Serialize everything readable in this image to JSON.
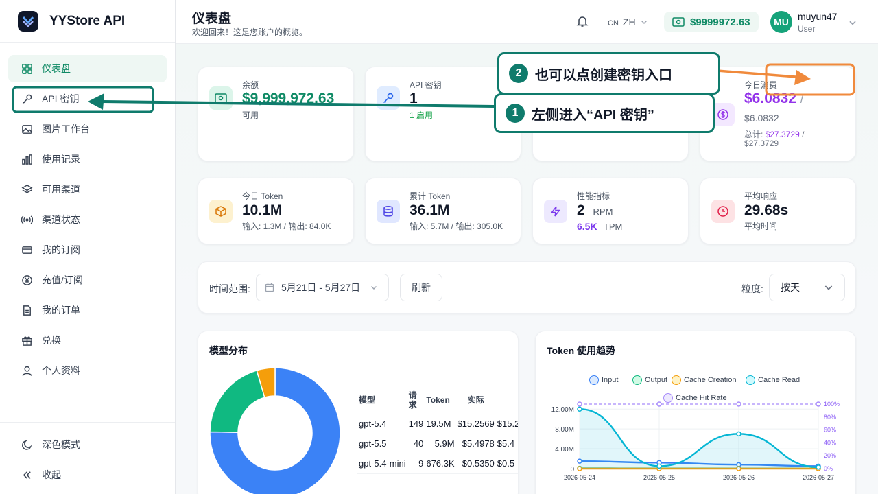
{
  "brand": {
    "name": "YYStore API"
  },
  "sidebar": {
    "items": [
      {
        "label": "仪表盘",
        "icon": "grid-icon"
      },
      {
        "label": "API 密钥",
        "icon": "key-icon"
      },
      {
        "label": "图片工作台",
        "icon": "image-icon"
      },
      {
        "label": "使用记录",
        "icon": "bar-chart-icon"
      },
      {
        "label": "可用渠道",
        "icon": "layers-icon"
      },
      {
        "label": "渠道状态",
        "icon": "signal-icon"
      },
      {
        "label": "我的订阅",
        "icon": "card-icon"
      },
      {
        "label": "充值/订阅",
        "icon": "yen-icon"
      },
      {
        "label": "我的订单",
        "icon": "file-icon"
      },
      {
        "label": "兑换",
        "icon": "gift-icon"
      },
      {
        "label": "个人资料",
        "icon": "user-icon"
      }
    ],
    "bottom": [
      {
        "label": "深色模式",
        "icon": "moon-icon"
      },
      {
        "label": "收起",
        "icon": "chevrons-left-icon"
      }
    ]
  },
  "header": {
    "title": "仪表盘",
    "subtitle": "欢迎回来！这是您账户的概览。",
    "lang_prefix": "CN",
    "lang": "ZH",
    "balance": "$9999972.63",
    "avatar": "MU",
    "user": "muyun47",
    "role": "User"
  },
  "stats_row1": {
    "balance": {
      "label": "余额",
      "value": "$9,999,972.63",
      "sub": "可用"
    },
    "api_keys": {
      "label": "API 密钥",
      "value": "1",
      "sub": "1 启用"
    },
    "today_cost": {
      "label": "今日消费",
      "value": "$6.0832",
      "value_sep": "/",
      "value2": "$6.0832",
      "total_label": "总计:",
      "total": "$27.3729",
      "total_sep": "/",
      "total2": "$27.3729"
    }
  },
  "stats_row2": {
    "today_token": {
      "label": "今日 Token",
      "value": "10.1M",
      "sub": "输入: 1.3M / 输出: 84.0K"
    },
    "total_token": {
      "label": "累计 Token",
      "value": "36.1M",
      "sub": "输入: 5.7M / 输出: 305.0K"
    },
    "performance": {
      "label": "性能指标",
      "value": "2",
      "unit": "RPM",
      "value2": "6.5K",
      "unit2": "TPM"
    },
    "latency": {
      "label": "平均响应",
      "value": "29.68s",
      "sub": "平均时间"
    }
  },
  "filters": {
    "range_label": "时间范围:",
    "range_value": "5月21日 - 5月27日",
    "refresh": "刷新",
    "granularity_label": "粒度:",
    "granularity_value": "按天"
  },
  "model_dist": {
    "title": "模型分布",
    "columns": [
      "模型",
      "请求",
      "Token",
      "实际"
    ],
    "rows": [
      {
        "model": "gpt-5.4",
        "requests": "149",
        "tokens": "19.5M",
        "actual": "$15.2569",
        "extra": "$15.2"
      },
      {
        "model": "gpt-5.5",
        "requests": "40",
        "tokens": "5.9M",
        "actual": "$5.4978",
        "extra": "$5.4"
      },
      {
        "model": "gpt-5.4-mini",
        "requests": "9",
        "tokens": "676.3K",
        "actual": "$0.5350",
        "extra": "$0.5"
      }
    ],
    "colors": [
      "#3b82f6",
      "#10b981",
      "#f59e0b"
    ]
  },
  "chart_data": {
    "type": "line",
    "title": "Token 使用趋势",
    "x": [
      "2026-05-24",
      "2026-05-25",
      "2026-05-26",
      "2026-05-27"
    ],
    "y_ticks": [
      "0",
      "4.00M",
      "8.00M",
      "12.00M"
    ],
    "y2_ticks": [
      "0%",
      "20%",
      "40%",
      "60%",
      "80%",
      "100%"
    ],
    "ylim": [
      0,
      13000000
    ],
    "y2lim": [
      0,
      100
    ],
    "series": [
      {
        "name": "Input",
        "color": "#3b82f6",
        "values": [
          1500000,
          1200000,
          800000,
          500000
        ]
      },
      {
        "name": "Output",
        "color": "#10b981",
        "values": [
          60000,
          40000,
          30000,
          20000
        ]
      },
      {
        "name": "Cache Creation",
        "color": "#f59e0b",
        "values": [
          0,
          0,
          0,
          0
        ]
      },
      {
        "name": "Cache Read",
        "color": "#06b6d4",
        "values": [
          12000000,
          500000,
          7000000,
          300000
        ]
      },
      {
        "name": "Cache Hit Rate",
        "color": "#a78bfa",
        "axis": "right",
        "values": [
          100,
          100,
          100,
          100
        ]
      }
    ]
  },
  "annotations": {
    "callout1_num": "1",
    "callout1_text": "左侧进入“API 密钥”",
    "callout2_num": "2",
    "callout2_text": "也可以点创建密钥入口"
  }
}
